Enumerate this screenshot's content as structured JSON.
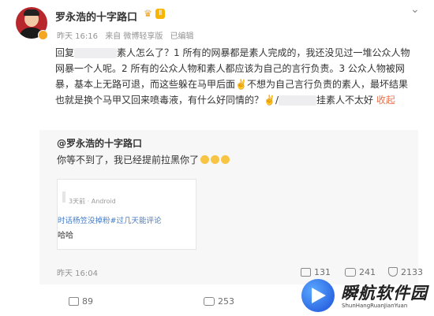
{
  "post": {
    "author": "罗永浩的十字路口",
    "level_badge": "Ⅱ",
    "time": "昨天 16:16",
    "source": "来自 微博轻享版",
    "edited": "已编辑",
    "reply_prefix": "回复",
    "text_1": "素人怎么了？1 所有的网暴都是素人完成的，我还没见过一堆公众人物网暴一个人呢。2 所有的公众人物和素人都应该为自己的言行负责。3 公众人物被网暴，基本上无路可退，而这些躲在马甲后面✌️不想为自己言行负责的素人，最坏结果也就是换个马甲又回来喷毒液，有什么好同情的？✌️/",
    "text_2": "挂素人不太好",
    "collapse": "收起"
  },
  "quoted": {
    "author": "@罗永浩的十字路口",
    "text": "你等不到了，我已经提前拉黑你了",
    "screenshot": {
      "info": "3天前 · Android",
      "link": "时话杨笠没掉粉#过几天能评论",
      "text": "哈哈"
    },
    "time": "昨天 16:04",
    "stats": {
      "share": "131",
      "comment": "241",
      "like": "2133"
    }
  },
  "footer": {
    "share": "89",
    "comment": "253"
  },
  "watermark": {
    "title": "瞬航软件园",
    "subtitle": "ShunHangRuanJianYuan"
  }
}
